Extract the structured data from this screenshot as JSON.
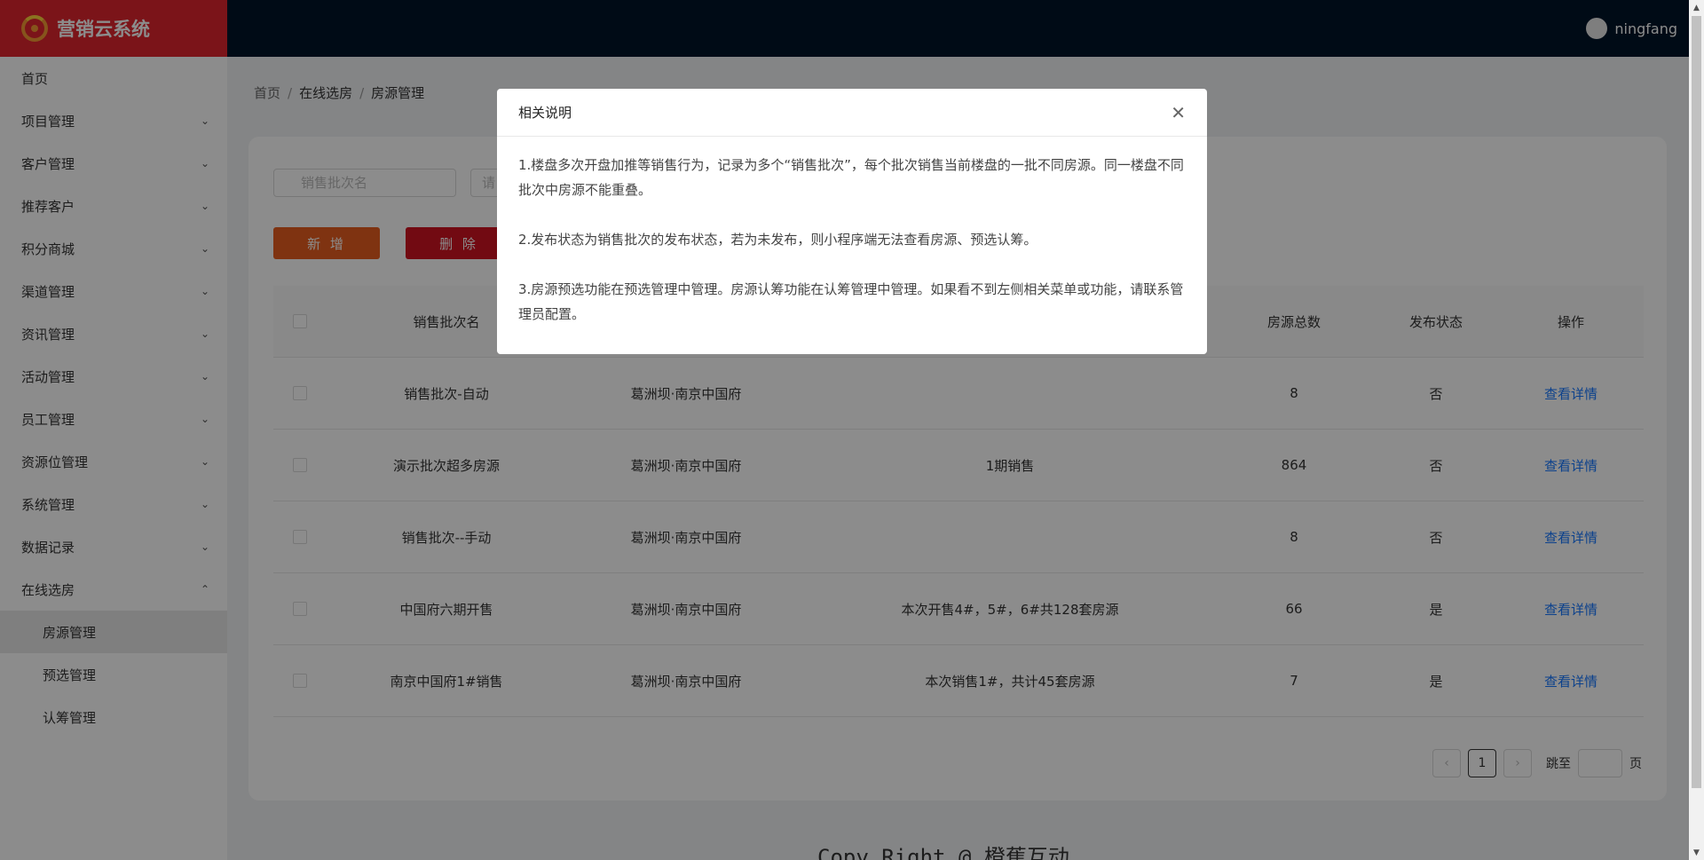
{
  "header": {
    "app_title": "营销云系统",
    "username": "ningfang"
  },
  "sidebar": {
    "items": [
      {
        "label": "首页"
      },
      {
        "label": "项目管理"
      },
      {
        "label": "客户管理"
      },
      {
        "label": "推荐客户"
      },
      {
        "label": "积分商城"
      },
      {
        "label": "渠道管理"
      },
      {
        "label": "资讯管理"
      },
      {
        "label": "活动管理"
      },
      {
        "label": "员工管理"
      },
      {
        "label": "资源位管理"
      },
      {
        "label": "系统管理"
      },
      {
        "label": "数据记录"
      },
      {
        "label": "在线选房"
      }
    ],
    "sub_items": [
      {
        "label": "房源管理"
      },
      {
        "label": "预选管理"
      },
      {
        "label": "认筹管理"
      }
    ]
  },
  "breadcrumb": {
    "home": "首页",
    "section": "在线选房",
    "current": "房源管理"
  },
  "filters": {
    "batch_name_placeholder": "销售批次名",
    "second_placeholder": "请"
  },
  "toolbar": {
    "add_label": "新 增",
    "delete_label": "删 除"
  },
  "table": {
    "headers": {
      "name": "销售批次名",
      "total": "房源总数",
      "status": "发布状态",
      "operation": "操作"
    },
    "rows": [
      {
        "name": "销售批次-自动",
        "project": "葛洲坝·南京中国府",
        "description": "",
        "total": "8",
        "status": "否",
        "action": "查看详情"
      },
      {
        "name": "演示批次超多房源",
        "project": "葛洲坝·南京中国府",
        "description": "1期销售",
        "total": "864",
        "status": "否",
        "action": "查看详情"
      },
      {
        "name": "销售批次--手动",
        "project": "葛洲坝·南京中国府",
        "description": "",
        "total": "8",
        "status": "否",
        "action": "查看详情"
      },
      {
        "name": "中国府六期开售",
        "project": "葛洲坝·南京中国府",
        "description": "本次开售4#，5#，6#共128套房源",
        "total": "66",
        "status": "是",
        "action": "查看详情"
      },
      {
        "name": "南京中国府1#销售",
        "project": "葛洲坝·南京中国府",
        "description": "本次销售1#，共计45套房源",
        "total": "7",
        "status": "是",
        "action": "查看详情"
      }
    ]
  },
  "pagination": {
    "current_page": "1",
    "jump_label": "跳至",
    "page_suffix": "页"
  },
  "footer": {
    "copyright": "Copy Right @ 橙蕉互动"
  },
  "modal": {
    "title": "相关说明",
    "paragraphs": [
      "1.楼盘多次开盘加推等销售行为，记录为多个“销售批次”，每个批次销售当前楼盘的一批不同房源。同一楼盘不同批次中房源不能重叠。",
      "2.发布状态为销售批次的发布状态，若为未发布，则小程序端无法查看房源、预选认筹。",
      "3.房源预选功能在预选管理中管理。房源认筹功能在认筹管理中管理。如果看不到左侧相关菜单或功能，请联系管理员配置。"
    ]
  },
  "colors": {
    "brand_red": "#e0262f",
    "header_bg": "#001529",
    "add_button": "#e85e1f",
    "delete_button": "#cf1322",
    "link": "#1677ff"
  }
}
